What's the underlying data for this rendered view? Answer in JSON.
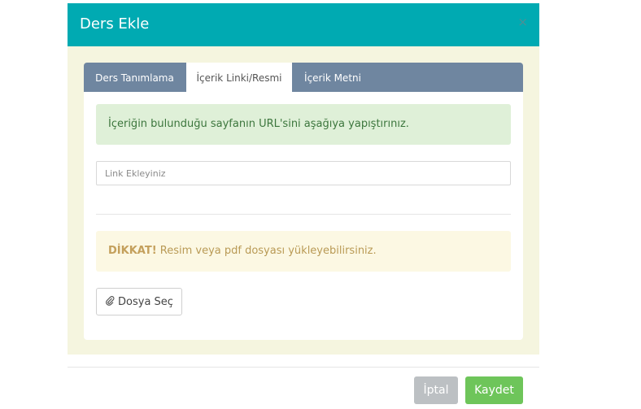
{
  "modal": {
    "title": "Ders Ekle",
    "close": "×"
  },
  "tabs": [
    {
      "label": "Ders Tanımlama"
    },
    {
      "label": "İçerik Linki/Resmi"
    },
    {
      "label": "İçerik Metni"
    }
  ],
  "panel": {
    "info_text": "İçeriğin bulunduğu sayfanın URL'sini aşağıya yapıştırınız.",
    "link_placeholder": "Link Ekleyiniz",
    "warning_strong": "DİKKAT!",
    "warning_text": " Resim veya pdf dosyası yükleyebilirsiniz.",
    "file_button": "Dosya Seç"
  },
  "footer": {
    "cancel_label": "İptal",
    "save_label": "Kaydet"
  },
  "colors": {
    "header": "#00aab2",
    "tabs_bg": "#6f86a0",
    "save": "#6ec55a",
    "cancel": "#bcc0c3"
  }
}
